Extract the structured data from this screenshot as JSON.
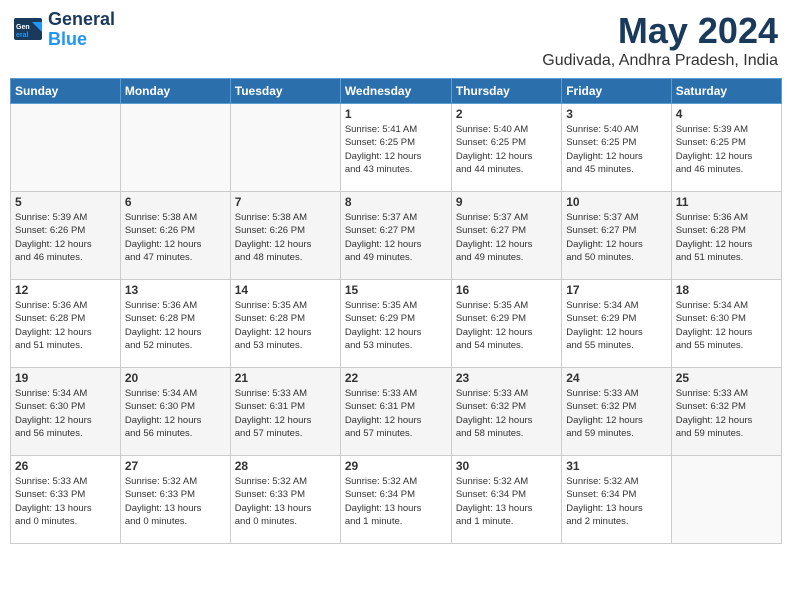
{
  "header": {
    "logo_line1": "General",
    "logo_line2": "Blue",
    "month": "May 2024",
    "location": "Gudivada, Andhra Pradesh, India"
  },
  "weekdays": [
    "Sunday",
    "Monday",
    "Tuesday",
    "Wednesday",
    "Thursday",
    "Friday",
    "Saturday"
  ],
  "weeks": [
    [
      {
        "day": "",
        "info": ""
      },
      {
        "day": "",
        "info": ""
      },
      {
        "day": "",
        "info": ""
      },
      {
        "day": "1",
        "info": "Sunrise: 5:41 AM\nSunset: 6:25 PM\nDaylight: 12 hours\nand 43 minutes."
      },
      {
        "day": "2",
        "info": "Sunrise: 5:40 AM\nSunset: 6:25 PM\nDaylight: 12 hours\nand 44 minutes."
      },
      {
        "day": "3",
        "info": "Sunrise: 5:40 AM\nSunset: 6:25 PM\nDaylight: 12 hours\nand 45 minutes."
      },
      {
        "day": "4",
        "info": "Sunrise: 5:39 AM\nSunset: 6:25 PM\nDaylight: 12 hours\nand 46 minutes."
      }
    ],
    [
      {
        "day": "5",
        "info": "Sunrise: 5:39 AM\nSunset: 6:26 PM\nDaylight: 12 hours\nand 46 minutes."
      },
      {
        "day": "6",
        "info": "Sunrise: 5:38 AM\nSunset: 6:26 PM\nDaylight: 12 hours\nand 47 minutes."
      },
      {
        "day": "7",
        "info": "Sunrise: 5:38 AM\nSunset: 6:26 PM\nDaylight: 12 hours\nand 48 minutes."
      },
      {
        "day": "8",
        "info": "Sunrise: 5:37 AM\nSunset: 6:27 PM\nDaylight: 12 hours\nand 49 minutes."
      },
      {
        "day": "9",
        "info": "Sunrise: 5:37 AM\nSunset: 6:27 PM\nDaylight: 12 hours\nand 49 minutes."
      },
      {
        "day": "10",
        "info": "Sunrise: 5:37 AM\nSunset: 6:27 PM\nDaylight: 12 hours\nand 50 minutes."
      },
      {
        "day": "11",
        "info": "Sunrise: 5:36 AM\nSunset: 6:28 PM\nDaylight: 12 hours\nand 51 minutes."
      }
    ],
    [
      {
        "day": "12",
        "info": "Sunrise: 5:36 AM\nSunset: 6:28 PM\nDaylight: 12 hours\nand 51 minutes."
      },
      {
        "day": "13",
        "info": "Sunrise: 5:36 AM\nSunset: 6:28 PM\nDaylight: 12 hours\nand 52 minutes."
      },
      {
        "day": "14",
        "info": "Sunrise: 5:35 AM\nSunset: 6:28 PM\nDaylight: 12 hours\nand 53 minutes."
      },
      {
        "day": "15",
        "info": "Sunrise: 5:35 AM\nSunset: 6:29 PM\nDaylight: 12 hours\nand 53 minutes."
      },
      {
        "day": "16",
        "info": "Sunrise: 5:35 AM\nSunset: 6:29 PM\nDaylight: 12 hours\nand 54 minutes."
      },
      {
        "day": "17",
        "info": "Sunrise: 5:34 AM\nSunset: 6:29 PM\nDaylight: 12 hours\nand 55 minutes."
      },
      {
        "day": "18",
        "info": "Sunrise: 5:34 AM\nSunset: 6:30 PM\nDaylight: 12 hours\nand 55 minutes."
      }
    ],
    [
      {
        "day": "19",
        "info": "Sunrise: 5:34 AM\nSunset: 6:30 PM\nDaylight: 12 hours\nand 56 minutes."
      },
      {
        "day": "20",
        "info": "Sunrise: 5:34 AM\nSunset: 6:30 PM\nDaylight: 12 hours\nand 56 minutes."
      },
      {
        "day": "21",
        "info": "Sunrise: 5:33 AM\nSunset: 6:31 PM\nDaylight: 12 hours\nand 57 minutes."
      },
      {
        "day": "22",
        "info": "Sunrise: 5:33 AM\nSunset: 6:31 PM\nDaylight: 12 hours\nand 57 minutes."
      },
      {
        "day": "23",
        "info": "Sunrise: 5:33 AM\nSunset: 6:32 PM\nDaylight: 12 hours\nand 58 minutes."
      },
      {
        "day": "24",
        "info": "Sunrise: 5:33 AM\nSunset: 6:32 PM\nDaylight: 12 hours\nand 59 minutes."
      },
      {
        "day": "25",
        "info": "Sunrise: 5:33 AM\nSunset: 6:32 PM\nDaylight: 12 hours\nand 59 minutes."
      }
    ],
    [
      {
        "day": "26",
        "info": "Sunrise: 5:33 AM\nSunset: 6:33 PM\nDaylight: 13 hours\nand 0 minutes."
      },
      {
        "day": "27",
        "info": "Sunrise: 5:32 AM\nSunset: 6:33 PM\nDaylight: 13 hours\nand 0 minutes."
      },
      {
        "day": "28",
        "info": "Sunrise: 5:32 AM\nSunset: 6:33 PM\nDaylight: 13 hours\nand 0 minutes."
      },
      {
        "day": "29",
        "info": "Sunrise: 5:32 AM\nSunset: 6:34 PM\nDaylight: 13 hours\nand 1 minute."
      },
      {
        "day": "30",
        "info": "Sunrise: 5:32 AM\nSunset: 6:34 PM\nDaylight: 13 hours\nand 1 minute."
      },
      {
        "day": "31",
        "info": "Sunrise: 5:32 AM\nSunset: 6:34 PM\nDaylight: 13 hours\nand 2 minutes."
      },
      {
        "day": "",
        "info": ""
      }
    ]
  ]
}
